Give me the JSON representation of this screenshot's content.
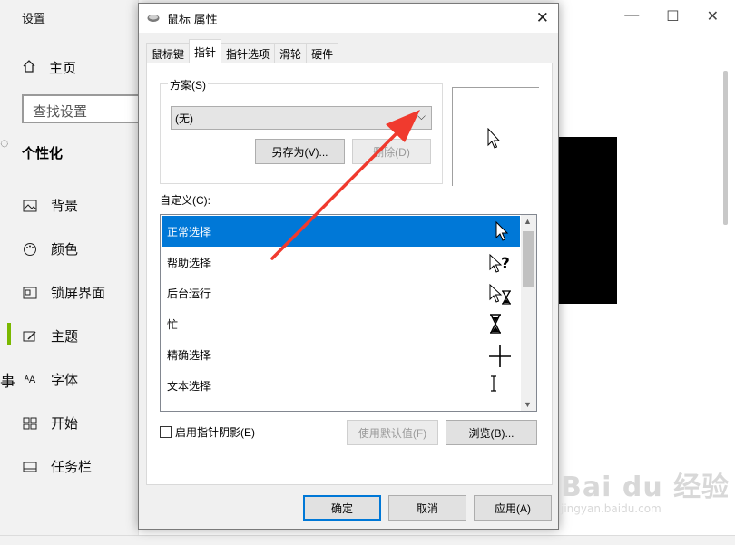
{
  "settings": {
    "title": "设置",
    "home": "主页",
    "search_placeholder": "查找设置",
    "section": "个性化",
    "items": [
      {
        "label": "背景",
        "icon": "image-icon"
      },
      {
        "label": "颜色",
        "icon": "palette-icon"
      },
      {
        "label": "锁屏界面",
        "icon": "lock-screen-icon"
      },
      {
        "label": "主题",
        "icon": "theme-icon"
      },
      {
        "label": "字体",
        "icon": "font-icon"
      },
      {
        "label": "开始",
        "icon": "start-icon"
      },
      {
        "label": "任务栏",
        "icon": "taskbar-icon"
      }
    ],
    "partial_text": "事",
    "accent_color": "#7ab800"
  },
  "dialog": {
    "title": "鼠标 属性",
    "tabs": [
      "鼠标键",
      "指针",
      "指针选项",
      "滑轮",
      "硬件"
    ],
    "active_tab": "指针",
    "scheme_label": "方案(S)",
    "scheme_value": "(无)",
    "save_as": "另存为(V)...",
    "delete": "删除(D)",
    "customize_label": "自定义(C):",
    "cursors": [
      {
        "label": "正常选择",
        "icon": "arrow-cursor-icon",
        "selected": true
      },
      {
        "label": "帮助选择",
        "icon": "help-cursor-icon",
        "selected": false
      },
      {
        "label": "后台运行",
        "icon": "working-cursor-icon",
        "selected": false
      },
      {
        "label": "忙",
        "icon": "hourglass-cursor-icon",
        "selected": false
      },
      {
        "label": "精确选择",
        "icon": "crosshair-cursor-icon",
        "selected": false
      },
      {
        "label": "文本选择",
        "icon": "text-cursor-icon",
        "selected": false
      }
    ],
    "enable_shadow": "启用指针阴影(E)",
    "use_default": "使用默认值(F)",
    "browse": "浏览(B)...",
    "ok": "确定",
    "cancel": "取消",
    "apply": "应用(A)",
    "selection_color": "#0078d7"
  },
  "watermark": {
    "logo": "Bai du 经验",
    "url": "jingyan.baidu.com"
  },
  "annotation_color": "#f03a2e"
}
